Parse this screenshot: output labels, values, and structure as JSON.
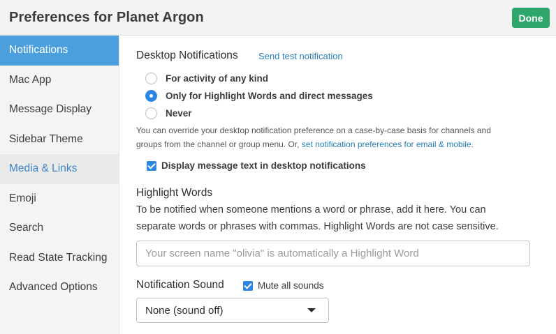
{
  "header": {
    "title": "Preferences for Planet Argon",
    "done_label": "Done"
  },
  "sidebar": {
    "items": [
      {
        "label": "Notifications"
      },
      {
        "label": "Mac App"
      },
      {
        "label": "Message Display"
      },
      {
        "label": "Sidebar Theme"
      },
      {
        "label": "Media & Links"
      },
      {
        "label": "Emoji"
      },
      {
        "label": "Search"
      },
      {
        "label": "Read State Tracking"
      },
      {
        "label": "Advanced Options"
      }
    ]
  },
  "desktop": {
    "title": "Desktop Notifications",
    "test_link": "Send test notification",
    "options": [
      {
        "label": "For activity of any kind",
        "selected": false
      },
      {
        "label": "Only for Highlight Words and direct messages",
        "selected": true
      },
      {
        "label": "Never",
        "selected": false
      }
    ],
    "description_line1": "You can override your desktop notification preference on a case-by-case basis for channels and",
    "description_line2": "groups from the channel or group menu. Or, ",
    "description_link": "set notification preferences for email & mobile",
    "description_end": ".",
    "display_text_label": "Display message text in desktop notifications",
    "display_text_checked": true
  },
  "highlight": {
    "title": "Highlight Words",
    "description_line1": "To be notified when someone mentions a word or phrase, add it here. You can",
    "description_line2": "separate words or phrases with commas. Highlight Words are not case sensitive.",
    "value": "",
    "placeholder": "Your screen name \"olivia\" is automatically a Highlight Word"
  },
  "sound": {
    "title": "Notification Sound",
    "mute_label": "Mute all sounds",
    "mute_checked": true,
    "selected": "None (sound off)"
  },
  "colors": {
    "accent": "#4a9fdc",
    "done": "#2fa66b",
    "link": "#2a80b9",
    "check": "#2d87e2"
  }
}
